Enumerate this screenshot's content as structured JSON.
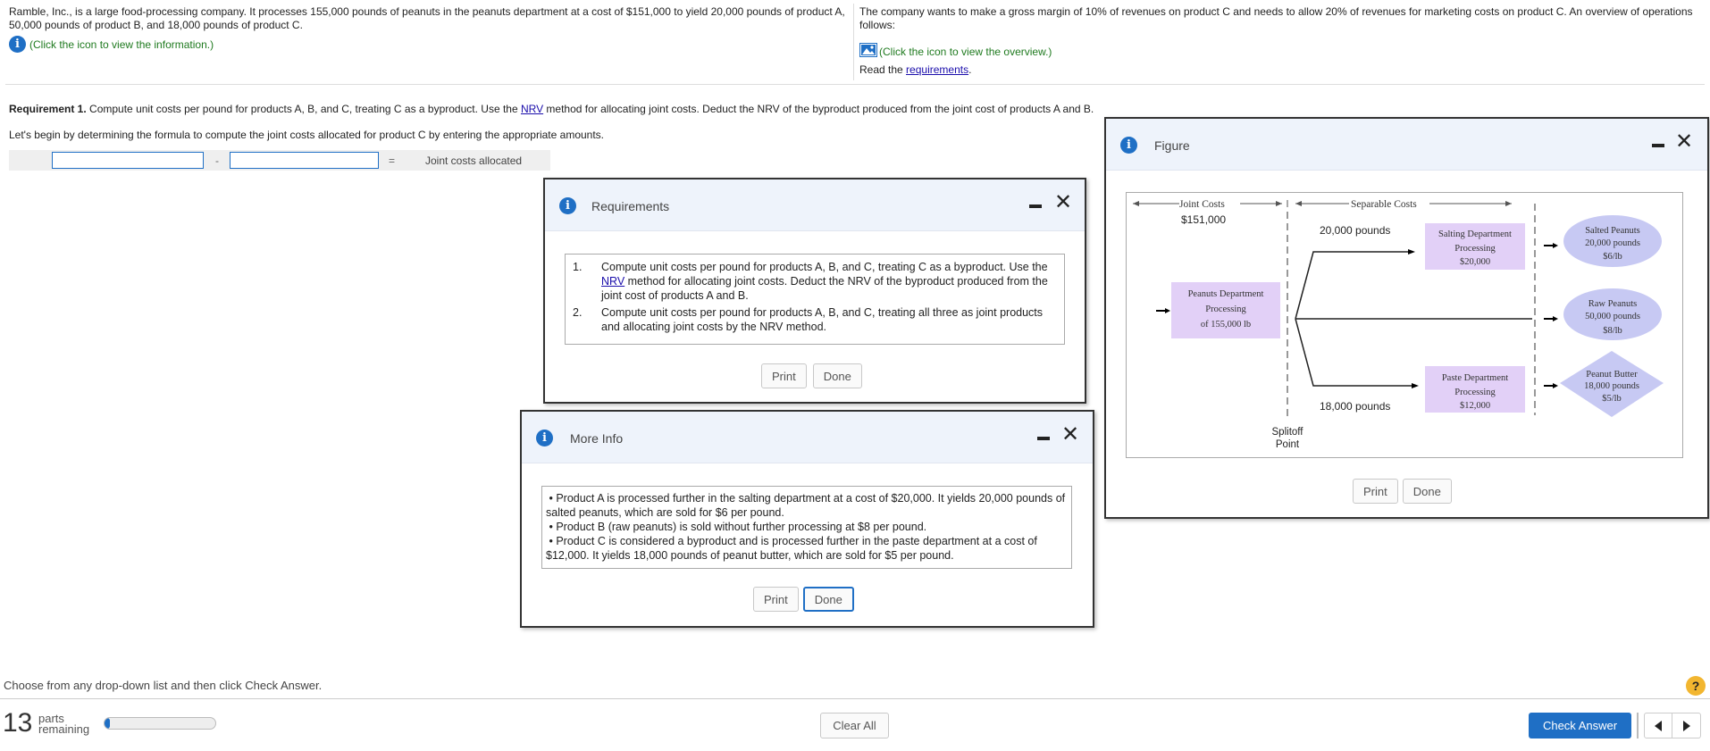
{
  "problem": {
    "left_text": "Ramble, Inc., is a large food-processing company. It processes 155,000 pounds of peanuts in the peanuts department at a cost of $151,000 to yield 20,000 pounds of product A, 50,000 pounds of product B, and 18,000 pounds of product C.",
    "info_link": "(Click the icon to view the information.)",
    "right_text": "The company wants to make a gross margin of 10% of revenues on product C and needs to allow 20% of revenues for marketing costs on product C. An overview of operations follows:",
    "overview_link": "(Click the icon to view the overview.)",
    "read_prefix": "Read the ",
    "requirements_link": "requirements",
    "read_suffix": "."
  },
  "requirement": {
    "bold": "Requirement 1.",
    "text_before": " Compute unit costs per pound for products A, B, and C, treating C as a byproduct. Use the ",
    "nrv": "NRV",
    "text_after": " method for allocating joint costs. Deduct the NRV of the byproduct produced from the joint cost of products A and B.",
    "instruction": "Let's begin by determining the formula to compute the joint costs allocated for product C by entering the appropriate amounts.",
    "formula": {
      "input1": "",
      "minus": "-",
      "input2": "",
      "equals": "=",
      "result_label": "Joint costs allocated"
    }
  },
  "requirements_dialog": {
    "title": "Requirements",
    "items": [
      {
        "num": "1.",
        "before": "Compute unit costs per pound for products A, B, and C, treating C as a byproduct. Use the ",
        "nrv": "NRV",
        "after": " method for allocating joint costs. Deduct the NRV of the byproduct produced from the joint cost of products A and B."
      },
      {
        "num": "2.",
        "before": "Compute unit costs per pound for products A, B, and C, treating all three as joint products and allocating joint costs by the NRV method.",
        "nrv": "",
        "after": ""
      }
    ],
    "print": "Print",
    "done": "Done"
  },
  "moreinfo_dialog": {
    "title": "More Info",
    "bullets": [
      "Product A is processed further in the salting department at a cost of $20,000. It yields 20,000 pounds of salted peanuts, which are sold for $6 per pound.",
      "Product B (raw peanuts) is sold without further processing at $8 per pound.",
      "Product C is considered a byproduct and is processed further in the paste department at a cost of $12,000. It yields 18,000 pounds of peanut butter,  which are sold for $5 per pound."
    ],
    "print": "Print",
    "done": "Done"
  },
  "figure_dialog": {
    "title": "Figure",
    "joint_costs_label": "Joint Costs",
    "joint_costs_amount": "$151,000",
    "separable_costs_label": "Separable Costs",
    "peanuts_dept": [
      "Peanuts Department",
      "Processing",
      "of 155,000 lb"
    ],
    "pounds_top": "20,000 pounds",
    "pounds_bottom": "18,000 pounds",
    "salting_dept": [
      "Salting Department",
      "Processing",
      "$20,000"
    ],
    "paste_dept": [
      "Paste Department",
      "Processing",
      "$12,000"
    ],
    "salted_peanuts": [
      "Salted Peanuts",
      "20,000  pounds",
      "$6/lb"
    ],
    "raw_peanuts": [
      "Raw Peanuts",
      "50,000  pounds",
      "$8/lb"
    ],
    "peanut_butter": [
      "Peanut Butter",
      "18,000  pounds",
      "$5/lb"
    ],
    "splitoff": [
      "Splitoff",
      "Point"
    ],
    "print": "Print",
    "done": "Done",
    "colors": {
      "box": "#e2d0f7",
      "product": "#c7c9f3"
    }
  },
  "footer": {
    "instruction": "Choose from any drop-down list and then click Check Answer.",
    "parts_count": "13",
    "parts_label_1": "parts",
    "parts_label_2": "remaining",
    "progress": 0.05,
    "clear_all": "Clear All",
    "check_answer": "Check Answer",
    "help_icon": "?"
  }
}
